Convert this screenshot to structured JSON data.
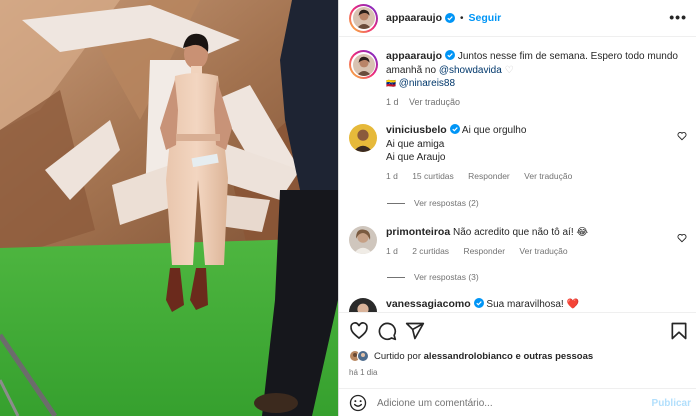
{
  "header": {
    "username": "appaaraujo",
    "separator": "•",
    "follow_label": "Seguir",
    "more_label": "•••"
  },
  "caption": {
    "username": "appaaraujo",
    "text": "Juntos nesse fim de semana. Espero todo mundo amanhã no",
    "mention1": "@showdavida",
    "emoji1": "♡",
    "flag": "🇻🇪",
    "mention2": "@ninareis88",
    "age": "1 d",
    "translate": "Ver tradução"
  },
  "comments": [
    {
      "username": "viniciusbelo",
      "lines": [
        "Ai que orgulho",
        "Ai que amiga",
        "Ai que Araujo"
      ],
      "age": "1 d",
      "likes": "15 curtidas",
      "reply": "Responder",
      "translate": "Ver tradução",
      "replies": "Ver respostas (2)"
    },
    {
      "username": "primonteiroa",
      "text": "Não acredito que não tô aí! 😂",
      "age": "1 d",
      "likes": "2 curtidas",
      "reply": "Responder",
      "translate": "Ver tradução",
      "replies": "Ver respostas (3)"
    },
    {
      "username": "vanessagiacomo",
      "text": "Sua maravilhosa! ❤️"
    }
  ],
  "footer": {
    "liked_prefix": "Curtido por",
    "liked_user": "alessandrolobianco",
    "liked_suffix": "e outras pessoas",
    "time": "há 1 dia",
    "comment_placeholder": "Adicione um comentário...",
    "publish_label": "Publicar"
  },
  "icons": {
    "like": "heart-icon",
    "comment": "comment-icon",
    "share": "share-icon",
    "save": "bookmark-icon",
    "emoji": "emoji-icon",
    "verified": "verified-badge-icon"
  },
  "colors": {
    "link_blue": "#0095f6",
    "mention_blue": "#00376b",
    "muted": "#737373",
    "green_floor": "#3fae36",
    "heart_red": "#ed4956"
  }
}
